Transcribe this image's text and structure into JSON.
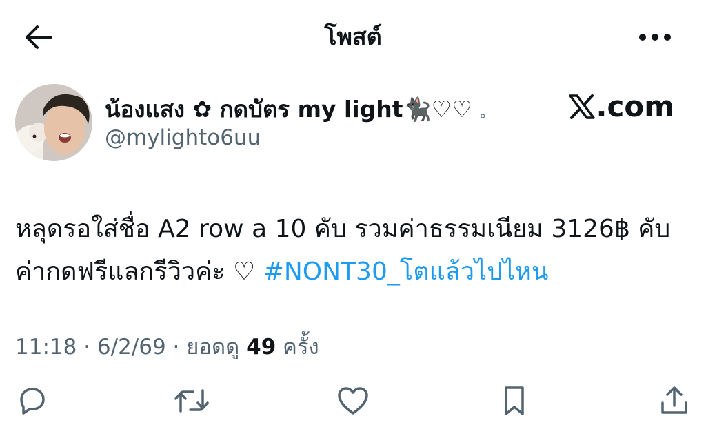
{
  "header": {
    "title": "โพสต์",
    "back_icon": "arrow-left-icon",
    "more_icon": "more-horizontal-icon"
  },
  "author": {
    "display_name": "น้องแสง ✿ กดบัตร my light🐈‍⬛♡♡",
    "name_suffix": "。",
    "handle": "@mylighto6uu",
    "source_label": ".com",
    "source_icon": "x-logo-icon"
  },
  "tweet": {
    "text_part1": "หลุดรอใส่ชื่อ A2 row a 10 คับ รวมค่าธรรมเนียม 3126฿ คับ ค่ากดฟรีแลกรีวิวค่ะ ♡ ",
    "hashtag": "#NONT30_โตแล้วไปไหน"
  },
  "meta": {
    "time": "11:18",
    "separator1": " · ",
    "date": "6/2/69",
    "separator2": " · ",
    "views_label": "ยอดดู ",
    "views_count": "49",
    "views_unit": " ครั้ง"
  },
  "actions": {
    "reply_icon": "reply-icon",
    "retweet_icon": "retweet-icon",
    "like_icon": "like-icon",
    "bookmark_icon": "bookmark-icon",
    "share_icon": "share-icon"
  },
  "colors": {
    "text": "#0f1419",
    "secondary": "#536471",
    "link": "#1d9bf0"
  }
}
